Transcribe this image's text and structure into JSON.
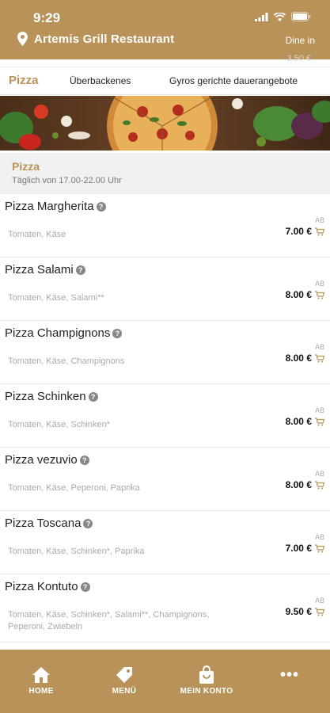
{
  "status_bar": {
    "time": "9:29"
  },
  "header": {
    "restaurant_name": "Artemis Grill Restaurant",
    "mode": "Dine in"
  },
  "tabs": [
    {
      "label": "Pizza",
      "active": true
    },
    {
      "label": "Überbackenes",
      "active": false
    },
    {
      "label": "Gyros gerichte dauerangebote",
      "active": false
    }
  ],
  "category": {
    "name": "Pizza",
    "hours": "Täglich von 17.00-22.00 Uhr"
  },
  "items": [
    {
      "name": "Pizza Margherita",
      "description": "Tomaten, Käse",
      "ab": "AB",
      "price": "7.00 €"
    },
    {
      "name": "Pizza Salami",
      "description": "Tomaten, Käse, Salami**",
      "ab": "AB",
      "price": "8.00 €"
    },
    {
      "name": "Pizza Champignons",
      "description": "Tomaten, Käse, Champignons",
      "ab": "AB",
      "price": "8.00 €"
    },
    {
      "name": "Pizza Schinken",
      "description": "Tomaten, Käse, Schinken*",
      "ab": "AB",
      "price": "8.00 €"
    },
    {
      "name": "Pizza vezuvio",
      "description": "Tomaten, Käse, Peperoni, Paprika",
      "ab": "AB",
      "price": "8.00 €"
    },
    {
      "name": "Pizza Toscana",
      "description": "Tomaten, Käse, Schinken*, Paprika",
      "ab": "AB",
      "price": "7.00 €"
    },
    {
      "name": "Pizza Kontuto",
      "description": "Tomaten, Käse, Schinken*, Salami**, Champignons, Peperoni, Zwiebeln",
      "ab": "AB",
      "price": "9.50 €"
    }
  ],
  "bottom_nav": [
    {
      "label": "HOME",
      "icon": "home-icon"
    },
    {
      "label": "MENÜ",
      "icon": "tag-icon"
    },
    {
      "label": "MEIN KONTO",
      "icon": "bag-icon"
    },
    {
      "label": "",
      "icon": "more-icon"
    }
  ],
  "colors": {
    "brand": "#b89258",
    "category_bg": "#f1f1f1"
  }
}
